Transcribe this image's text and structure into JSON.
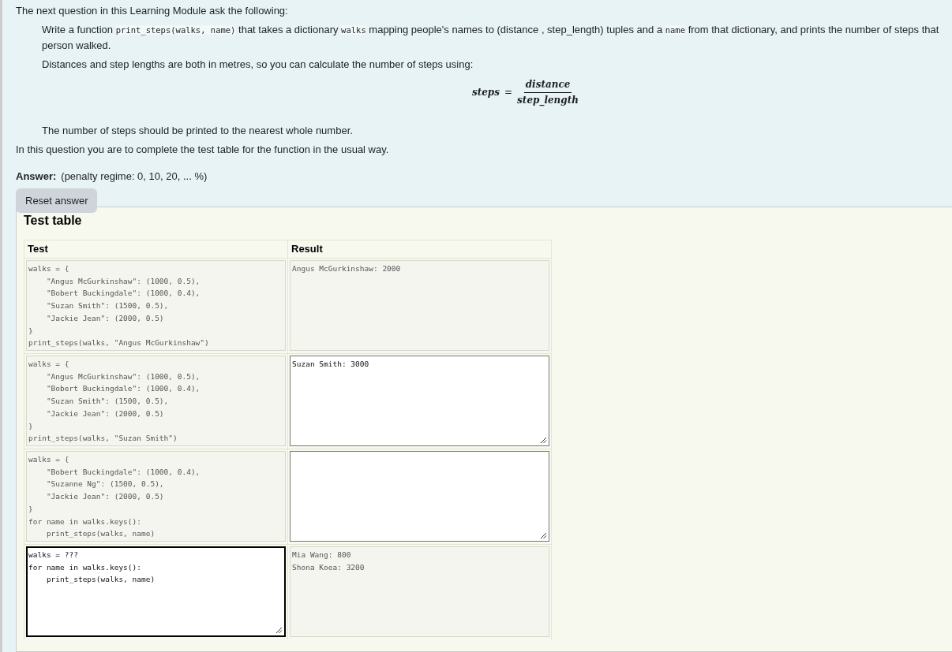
{
  "question": {
    "intro": "The next question in this Learning Module ask the following:",
    "paragraphs": [
      [
        {
          "kind": "text",
          "text": "Write a function "
        },
        {
          "kind": "code",
          "text": "print_steps(walks, name)"
        },
        {
          "kind": "text",
          "text": " that takes a dictionary "
        },
        {
          "kind": "code",
          "text": "walks"
        },
        {
          "kind": "text",
          "text": " mapping people's names to (distance , step_length) tuples and a "
        },
        {
          "kind": "code",
          "text": "name"
        },
        {
          "kind": "text",
          "text": " from that dictionary, and prints the number of steps that person walked."
        }
      ],
      [
        {
          "kind": "text",
          "text": "Distances and step lengths are both in metres, so you can calculate the number of steps using:"
        }
      ]
    ],
    "formula": {
      "lhs": "steps",
      "operator": "=",
      "numerator": "distance",
      "denominator": "step_length"
    },
    "note": "The number of steps should be printed to the nearest whole number.",
    "instruction": "In this question you are to complete the test table for the function in the usual way.",
    "answer_label": "Answer:",
    "penalty": "(penalty regime: 0, 10, 20, ... %)",
    "reset_button": "Reset answer"
  },
  "test_table": {
    "title": "Test table",
    "columns": [
      "Test",
      "Result"
    ],
    "rows": [
      {
        "test": {
          "text": "walks = {\n    \"Angus McGurkinshaw\": (1000, 0.5),\n    \"Bobert Buckingdale\": (1000, 0.4),\n    \"Suzan Smith\": (1500, 0.5),\n    \"Jackie Jean\": (2000, 0.5)\n}\nprint_steps(walks, \"Angus McGurkinshaw\")",
          "editable": false,
          "focused": false
        },
        "result": {
          "text": "Angus McGurkinshaw: 2000",
          "editable": false,
          "focused": false
        }
      },
      {
        "test": {
          "text": "walks = {\n    \"Angus McGurkinshaw\": (1000, 0.5),\n    \"Bobert Buckingdale\": (1000, 0.4),\n    \"Suzan Smith\": (1500, 0.5),\n    \"Jackie Jean\": (2000, 0.5)\n}\nprint_steps(walks, \"Suzan Smith\")",
          "editable": false,
          "focused": false
        },
        "result": {
          "text": "Suzan Smith: 3000",
          "editable": true,
          "focused": false
        }
      },
      {
        "test": {
          "text": "walks = {\n    \"Bobert Buckingdale\": (1000, 0.4),\n    \"Suzanne Ng\": (1500, 0.5),\n    \"Jackie Jean\": (2000, 0.5)\n}\nfor name in walks.keys():\n    print_steps(walks, name)",
          "editable": false,
          "focused": false
        },
        "result": {
          "editable": true,
          "focused": false
        }
      },
      {
        "test": {
          "text": "walks = ???\nfor name in walks.keys():\n    print_steps(walks, name)",
          "editable": true,
          "focused": true
        },
        "result": {
          "text": "Mia Wang: 800\nShona Koea: 3200",
          "editable": false,
          "focused": false
        }
      }
    ]
  }
}
